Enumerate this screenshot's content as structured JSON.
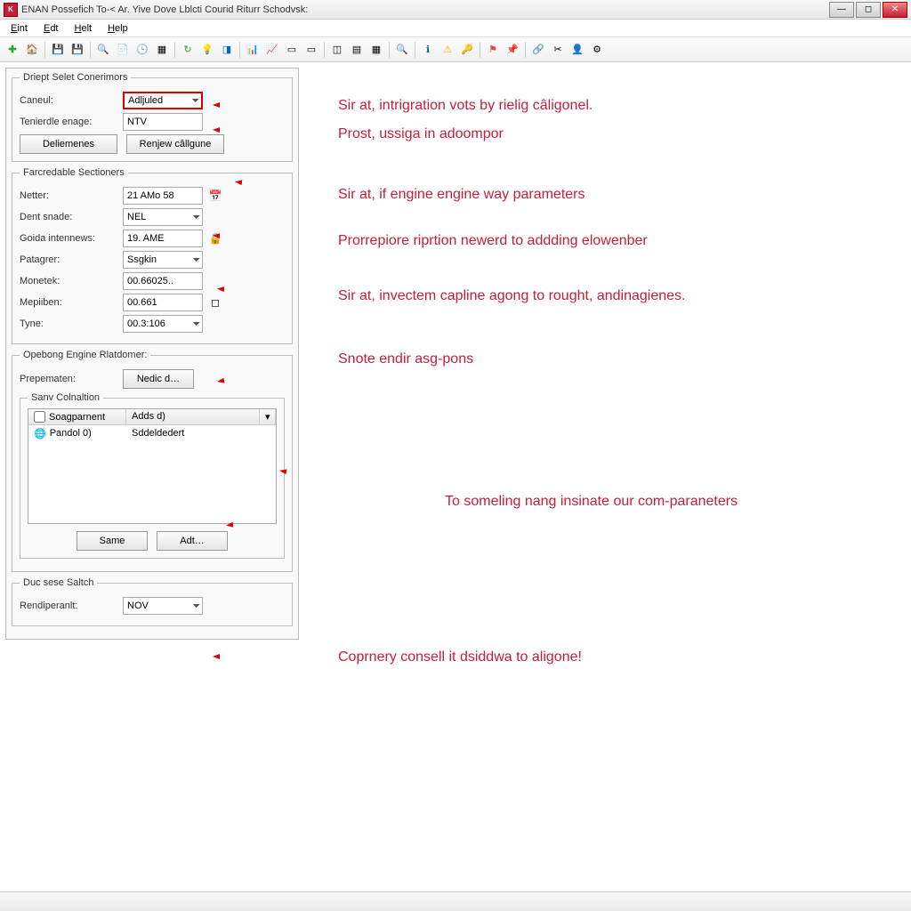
{
  "window": {
    "title": "ENAN Possefich To-< Ar. Yive Dove Lblcti Courid Riturr Schodvsk:",
    "app_icon_text": "K"
  },
  "menubar": [
    "Eint",
    "Edt",
    "Helt",
    "Help"
  ],
  "panel": {
    "group1": {
      "legend": "Driept Selet Conerimors",
      "caneul_label": "Caneul:",
      "caneul_value": "Adljuled",
      "tenerdle_label": "Tenierdle enage:",
      "tenerdle_value": "NTV",
      "btn1": "Deliemenes",
      "btn2": "Renjew câllgune"
    },
    "group2": {
      "legend": "Farcredable Sectioners",
      "netter_label": "Netter:",
      "netter_value": "21 AMo 58",
      "dent_label": "Dent snade:",
      "dent_value": "NEL",
      "goida_label": "Goida intennews:",
      "goida_value": "19. AME",
      "patagrer_label": "Patagrer:",
      "patagrer_value": "Ssgkin",
      "monetek_label": "Monetek:",
      "monetek_value": "00.66025..",
      "mepiiben_label": "Mepiiben:",
      "mepiiben_value": "00.661",
      "tyne_label": "Tyne:",
      "tyne_value": "00.3:106"
    },
    "group3": {
      "legend": "Opebong Engine Rlatdomer:",
      "prepematen_label": "Prepematen:",
      "prepematen_btn": "Nedic d…",
      "sub_legend": "Sanv Colnaltion",
      "col1_header": "Soagparnent",
      "col2_header": "Adds d)",
      "row1_col1": "Pandol 0)",
      "row1_col2": "Sddeldedert",
      "btn_same": "Same",
      "btn_adt": "Adt…"
    },
    "group4": {
      "legend": "Duc sese Saltch",
      "rend_label": "Rendiperanlt:",
      "rend_value": "NOV"
    }
  },
  "annotations": {
    "a1": "Sir at, intrigration vots by rielig câligonel.",
    "a2": "Prost, ussiga in adoompor",
    "a3": "Sir at, if engine engine way parameters",
    "a4": "Prorrepiore riprtion newerd to addding elowenber",
    "a5": "Sir at, invectem capline agong to rought, andinagienes.",
    "a6": "Snote endir asg-pons",
    "a7": "To someling nang insinate our com-paraneters",
    "a8": "Coprnery consell it dsiddwa to aligone!"
  }
}
